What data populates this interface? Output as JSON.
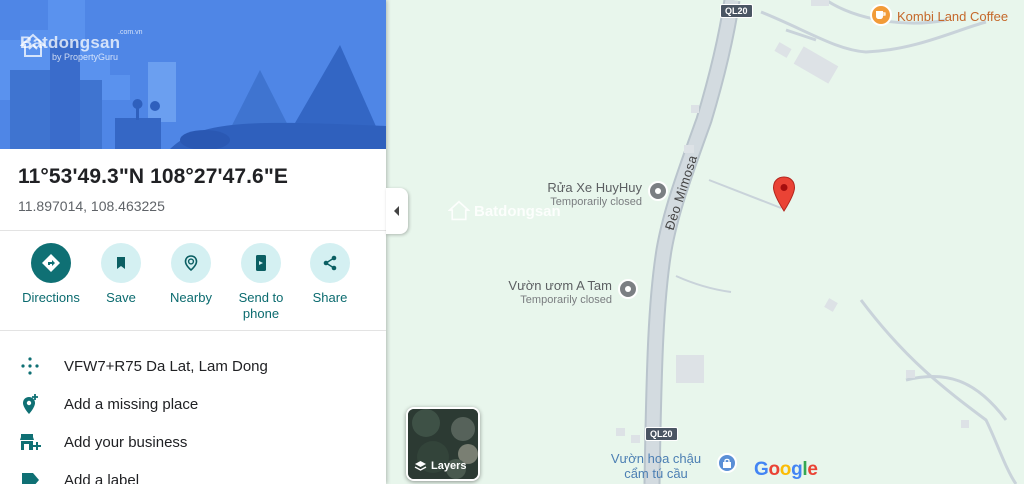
{
  "hero": {
    "watermark_name": "Batdongsan",
    "watermark_domain": ".com.vn",
    "watermark_sub": "by PropertyGuru"
  },
  "place": {
    "title": "11°53'49.3\"N 108°27'47.6\"E",
    "decimal": "11.897014, 108.463225"
  },
  "actions": [
    {
      "label": "Directions",
      "icon": "directions-icon"
    },
    {
      "label": "Save",
      "icon": "bookmark-icon"
    },
    {
      "label": "Nearby",
      "icon": "nearby-icon"
    },
    {
      "label": "Send to\nphone",
      "icon": "send-to-phone-icon"
    },
    {
      "label": "Share",
      "icon": "share-icon"
    }
  ],
  "rows": [
    {
      "text": "VFW7+R75 Da Lat, Lam Dong",
      "icon": "plus-code-icon"
    },
    {
      "text": "Add a missing place",
      "icon": "add-place-icon"
    },
    {
      "text": "Add your business",
      "icon": "add-business-icon"
    },
    {
      "text": "Add a label",
      "icon": "label-icon"
    }
  ],
  "map": {
    "road_name": "Đèo Mimosa",
    "route_shield_top": "QL20",
    "route_shield_bottom": "QL20",
    "pois": [
      {
        "name": "Rửa Xe HuyHuy",
        "status": "Temporarily closed"
      },
      {
        "name": "Vườn ươm A Tam",
        "status": "Temporarily closed"
      },
      {
        "name": "Kombi Land Coffee",
        "status": ""
      },
      {
        "name": "Vườn hoa chậu\ncẩm tú cầu",
        "status": ""
      }
    ],
    "map_watermark": "Batdongsan",
    "layers_label": "Layers",
    "google_logo": "Google"
  },
  "colors": {
    "accent": "#0f7074",
    "accent_light": "#d4f0f2",
    "map_bg": "#e8f6ec",
    "pin": "#ea4335",
    "hero_bg": "#4f86e6"
  }
}
